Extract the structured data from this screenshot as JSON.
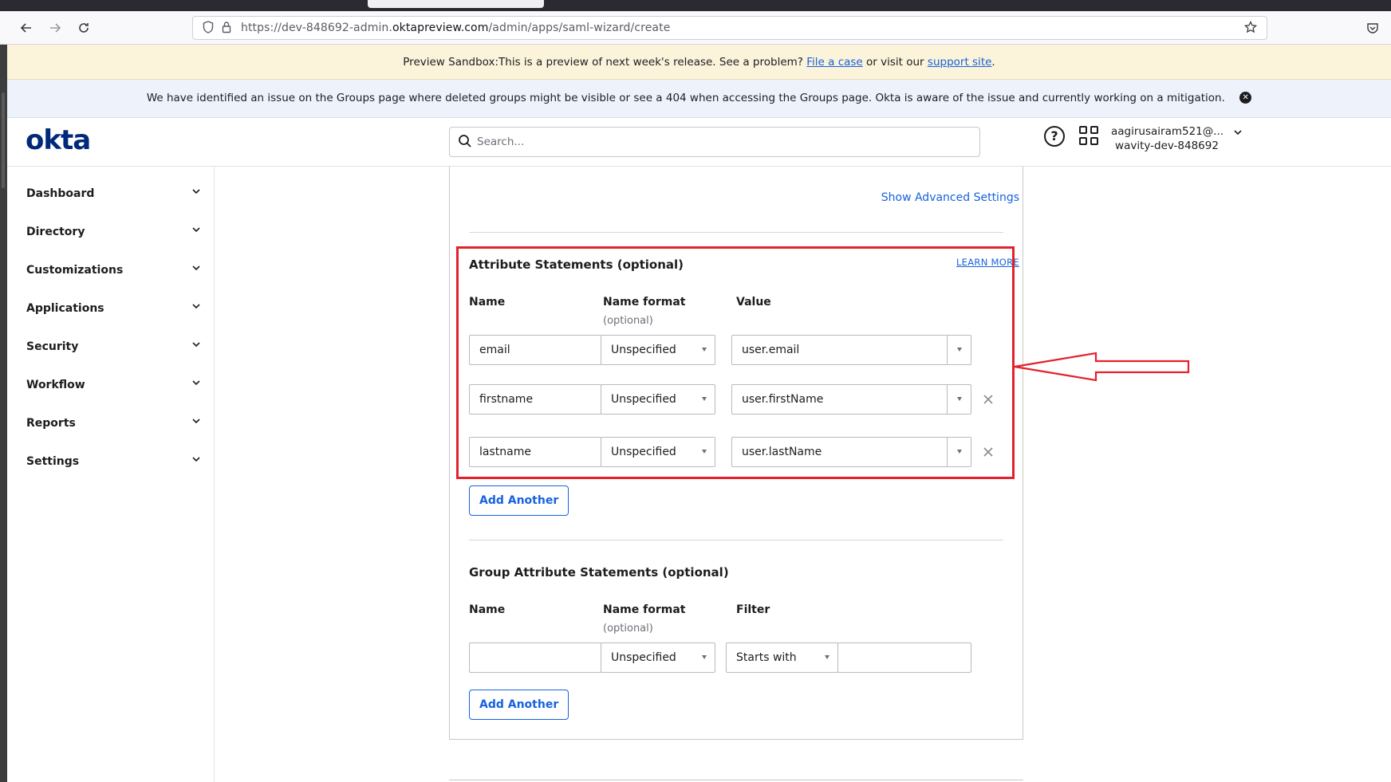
{
  "browser": {
    "url_prefix": "https://dev-848692-admin.",
    "url_domain": "oktapreview.com",
    "url_path": "/admin/apps/saml-wizard/create"
  },
  "preview_banner": {
    "text": "Preview Sandbox:This is a preview of next week's release. See a problem?",
    "link1": "File a case",
    "middle": "or visit our",
    "link2": "support site",
    "end": "."
  },
  "issue_banner": {
    "text": "We have identified an issue on the Groups page where deleted groups might be visible or see a 404 when accessing the Groups page. Okta is aware of the issue and currently working on a mitigation."
  },
  "header": {
    "logo": "okta",
    "search_placeholder": "Search...",
    "user_email": "aagirusairam521@...",
    "user_org": "wavity-dev-848692"
  },
  "sidebar": {
    "items": [
      {
        "label": "Dashboard"
      },
      {
        "label": "Directory"
      },
      {
        "label": "Customizations"
      },
      {
        "label": "Applications"
      },
      {
        "label": "Security"
      },
      {
        "label": "Workflow"
      },
      {
        "label": "Reports"
      },
      {
        "label": "Settings"
      }
    ]
  },
  "main": {
    "show_advanced": "Show Advanced Settings",
    "attr_section": {
      "title": "Attribute Statements (optional)",
      "learn_more": "LEARN MORE",
      "col_name": "Name",
      "col_format": "Name format",
      "col_format_sub": "(optional)",
      "col_value": "Value",
      "rows": [
        {
          "name": "email",
          "format": "Unspecified",
          "value": "user.email"
        },
        {
          "name": "firstname",
          "format": "Unspecified",
          "value": "user.firstName"
        },
        {
          "name": "lastname",
          "format": "Unspecified",
          "value": "user.lastName"
        }
      ],
      "add_button": "Add Another"
    },
    "group_section": {
      "title": "Group Attribute Statements (optional)",
      "col_name": "Name",
      "col_format": "Name format",
      "col_format_sub": "(optional)",
      "col_filter": "Filter",
      "row": {
        "name": "",
        "format": "Unspecified",
        "filter_type": "Starts with",
        "filter_value": ""
      },
      "add_button": "Add Another"
    }
  },
  "colors": {
    "okta_blue": "#00297a",
    "link_blue": "#1662dd",
    "annotation_red": "#e4212b"
  }
}
